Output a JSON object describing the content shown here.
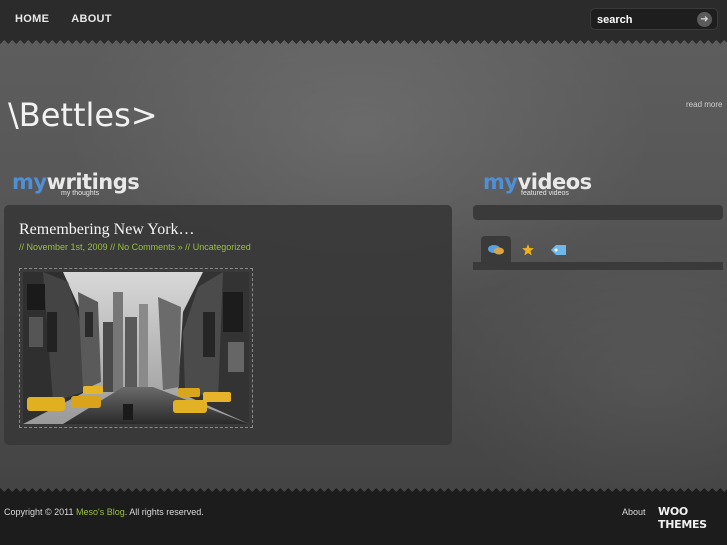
{
  "nav": {
    "items": [
      "HOME",
      "ABOUT"
    ]
  },
  "search": {
    "placeholder": "search",
    "go_icon": "arrow-right-icon"
  },
  "header": {
    "title": "\\Bettles>",
    "read_more": "read more"
  },
  "writings": {
    "my": "my",
    "rest": "writings",
    "subtitle": "my thoughts"
  },
  "videos": {
    "my": "my",
    "rest": "videos",
    "subtitle": "featured videos"
  },
  "post": {
    "title": "Remembering New York…",
    "date": "November 1st, 2009",
    "comments": "No Comments »",
    "category": "Uncategorized",
    "separator": "//",
    "image_alt": "Times Square street with yellow taxis"
  },
  "tabs": {
    "icons": [
      "speech-bubbles-icon",
      "star-icon",
      "tag-icon"
    ]
  },
  "footer": {
    "copy_prefix": "Copyright © 2011",
    "blog_link": "Meso's Blog",
    "copy_suffix": ". All rights reserved.",
    "about": "About",
    "brand": "WOO THEMES"
  },
  "colors": {
    "accent_blue": "#4f8fd6",
    "link_green": "#9bbf3a"
  }
}
